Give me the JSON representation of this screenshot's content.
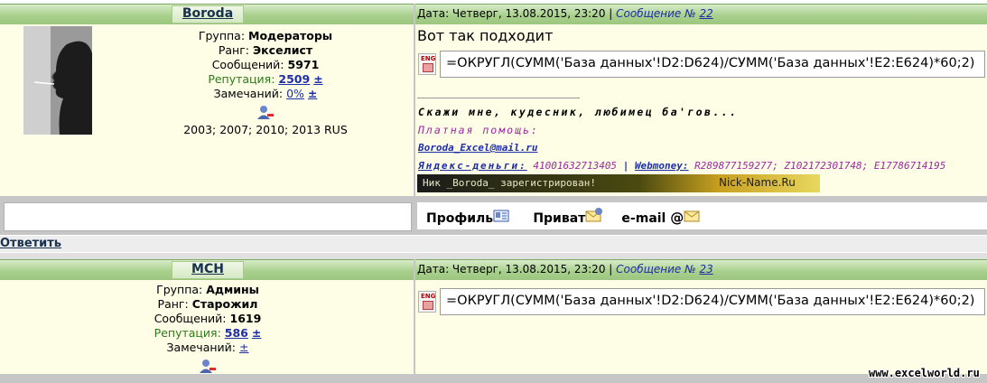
{
  "posts": [
    {
      "author": "Boroda",
      "group_label": "Группа:",
      "group": "Модераторы",
      "rank_label": "Ранг:",
      "rank": "Экселист",
      "messages_label": "Сообщений:",
      "messages": "5971",
      "rep_label": "Репутация:",
      "reputation": "2509",
      "rep_pm": "±",
      "warn_label": "Замечаний:",
      "warnings": "0%",
      "warn_pm": "±",
      "versions": "2003; 2007; 2010; 2013 RUS",
      "date_label": "Дата: Четверг, 13.08.2015, 23:20 |",
      "msg_label": "Сообщение №",
      "msg_no": "22",
      "body_text": "Вот так подходит",
      "formula": "=ОКРУГЛ(СУММ('База данных'!D2:D624)/СУММ('База данных'!E2:E624)*60;2)",
      "sig_line1": "Скажи мне, кудесник, любимец ба'гов...",
      "sig_paid": "Платная помощь:",
      "sig_email": "Boroda_Excel@mail.ru",
      "sig_yandex_label": "Яндекс-деньги:",
      "sig_yandex": "41001632713405",
      "sig_sep": "|",
      "sig_webmoney_label": "Webmoney:",
      "sig_webmoney": "R289877159277; Z102172301748; E17786714195",
      "banner_text": "Ник _Boroda_ зарегистрирован!",
      "banner_site": "Nick-Name.Ru",
      "btn_profile": "Профиль",
      "btn_private": "Приват",
      "btn_email": "e-mail"
    },
    {
      "author": "MCH",
      "group_label": "Группа:",
      "group": "Админы",
      "rank_label": "Ранг:",
      "rank": "Старожил",
      "messages_label": "Сообщений:",
      "messages": "1619",
      "rep_label": "Репутация:",
      "reputation": "586",
      "rep_pm": "±",
      "warn_label": "Замечаний:",
      "warn_pm": "±",
      "date_label": "Дата: Четверг, 13.08.2015, 23:20 |",
      "msg_label": "Сообщение №",
      "msg_no": "23",
      "formula": "=ОКРУГЛ(СУММ('База данных'!D2:D624)/СУММ('База данных'!E2:E624)*60;2)"
    }
  ],
  "reply_label": "Ответить",
  "watermark": "www.excelworld.ru",
  "colors": {
    "header_green": "#a9d08e",
    "cream": "#fefde6",
    "link_blue": "#1e2ea8",
    "rep_green": "#2e7a1a"
  }
}
